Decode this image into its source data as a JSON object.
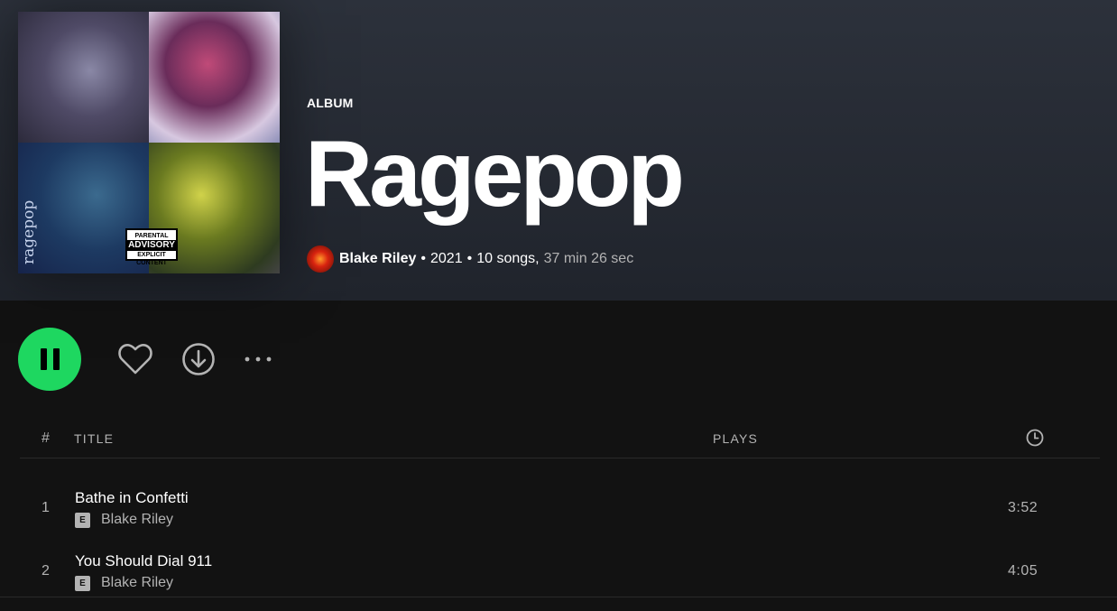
{
  "album": {
    "type_label": "ALBUM",
    "title": "Ragepop",
    "cover_badge_top": "PARENTAL",
    "cover_badge_main": "ADVISORY",
    "cover_badge_bottom": "EXPLICIT CONTENT",
    "cover_side_text": "ragepop"
  },
  "meta": {
    "artist": "Blake Riley",
    "bullet": "•",
    "year": "2021",
    "songs": "10 songs,",
    "duration": "37 min 26 sec"
  },
  "controls": {
    "play_state": "playing",
    "accent_color": "#1ed760"
  },
  "table": {
    "headers": {
      "number": "#",
      "title": "TITLE",
      "plays": "PLAYS"
    },
    "rows": [
      {
        "number": "1",
        "title": "Bathe in Confetti",
        "explicit": "E",
        "artist": "Blake Riley",
        "duration": "3:52"
      },
      {
        "number": "2",
        "title": "You Should Dial 911",
        "explicit": "E",
        "artist": "Blake Riley",
        "duration": "4:05"
      }
    ]
  },
  "icons": [
    "pause-icon",
    "heart-icon",
    "download-icon",
    "more-icon",
    "clock-icon"
  ]
}
